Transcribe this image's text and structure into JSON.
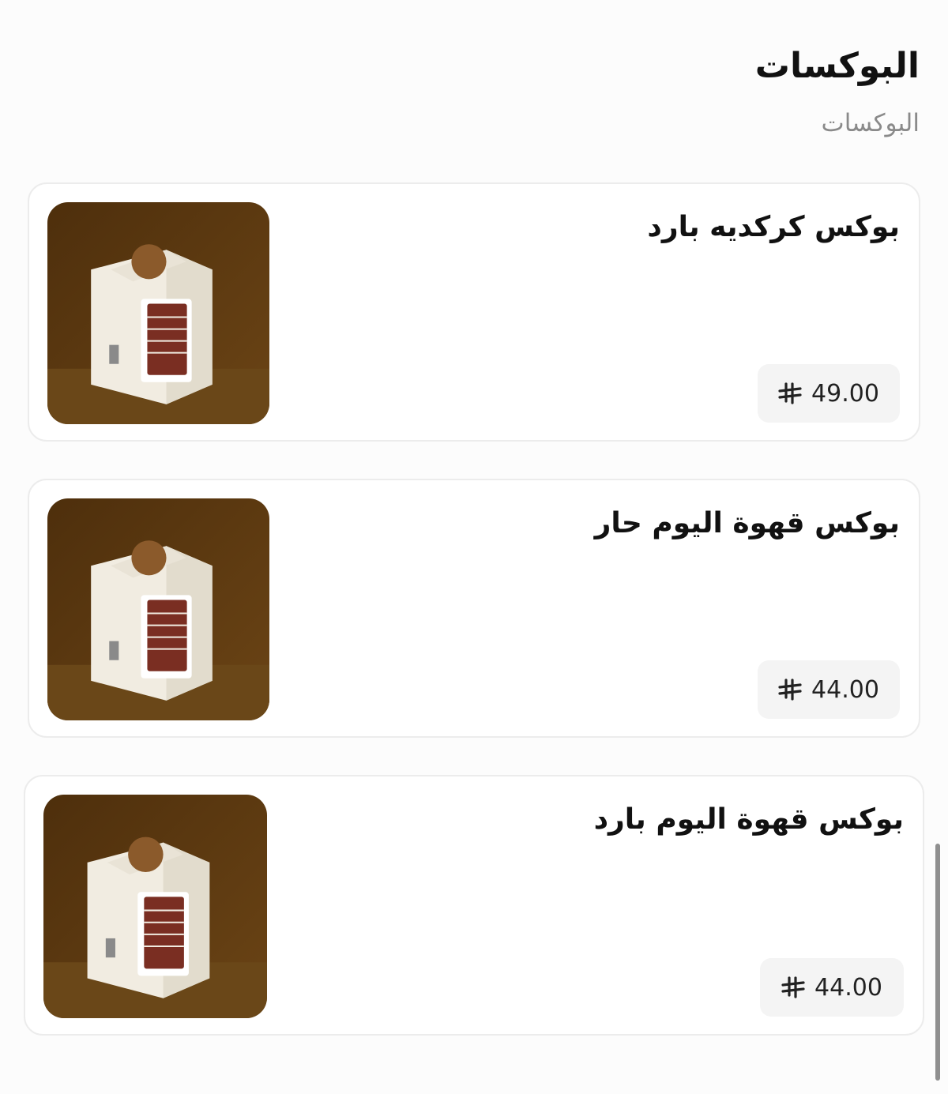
{
  "section": {
    "title": "البوكسات",
    "subtitle": "البوكسات"
  },
  "products": [
    {
      "name": "بوكس كركديه بارد",
      "price": "49.00",
      "image_icon": "product-box-image"
    },
    {
      "name": "بوكس قهوة اليوم حار",
      "price": "44.00",
      "image_icon": "product-box-image"
    },
    {
      "name": "بوكس قهوة اليوم بارد",
      "price": "44.00",
      "image_icon": "product-box-image"
    }
  ],
  "currency_icon": "saudi-riyal-icon",
  "colors": {
    "image_bg": "#5a3710",
    "box": "#f1ece1",
    "cups": "#7a2e22"
  }
}
